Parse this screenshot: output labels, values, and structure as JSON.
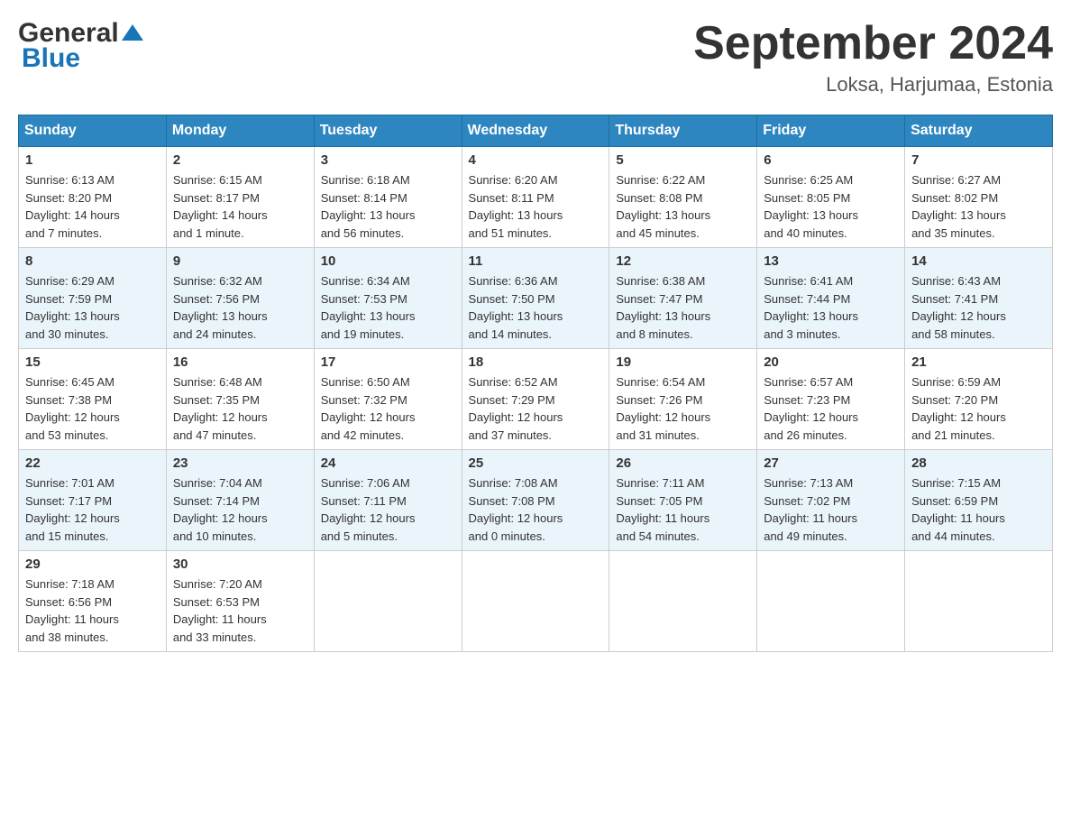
{
  "header": {
    "logo_general": "General",
    "logo_blue": "Blue",
    "title": "September 2024",
    "subtitle": "Loksa, Harjumaa, Estonia"
  },
  "weekdays": [
    "Sunday",
    "Monday",
    "Tuesday",
    "Wednesday",
    "Thursday",
    "Friday",
    "Saturday"
  ],
  "weeks": [
    [
      {
        "day": "1",
        "sunrise": "6:13 AM",
        "sunset": "8:20 PM",
        "daylight": "14 hours and 7 minutes."
      },
      {
        "day": "2",
        "sunrise": "6:15 AM",
        "sunset": "8:17 PM",
        "daylight": "14 hours and 1 minute."
      },
      {
        "day": "3",
        "sunrise": "6:18 AM",
        "sunset": "8:14 PM",
        "daylight": "13 hours and 56 minutes."
      },
      {
        "day": "4",
        "sunrise": "6:20 AM",
        "sunset": "8:11 PM",
        "daylight": "13 hours and 51 minutes."
      },
      {
        "day": "5",
        "sunrise": "6:22 AM",
        "sunset": "8:08 PM",
        "daylight": "13 hours and 45 minutes."
      },
      {
        "day": "6",
        "sunrise": "6:25 AM",
        "sunset": "8:05 PM",
        "daylight": "13 hours and 40 minutes."
      },
      {
        "day": "7",
        "sunrise": "6:27 AM",
        "sunset": "8:02 PM",
        "daylight": "13 hours and 35 minutes."
      }
    ],
    [
      {
        "day": "8",
        "sunrise": "6:29 AM",
        "sunset": "7:59 PM",
        "daylight": "13 hours and 30 minutes."
      },
      {
        "day": "9",
        "sunrise": "6:32 AM",
        "sunset": "7:56 PM",
        "daylight": "13 hours and 24 minutes."
      },
      {
        "day": "10",
        "sunrise": "6:34 AM",
        "sunset": "7:53 PM",
        "daylight": "13 hours and 19 minutes."
      },
      {
        "day": "11",
        "sunrise": "6:36 AM",
        "sunset": "7:50 PM",
        "daylight": "13 hours and 14 minutes."
      },
      {
        "day": "12",
        "sunrise": "6:38 AM",
        "sunset": "7:47 PM",
        "daylight": "13 hours and 8 minutes."
      },
      {
        "day": "13",
        "sunrise": "6:41 AM",
        "sunset": "7:44 PM",
        "daylight": "13 hours and 3 minutes."
      },
      {
        "day": "14",
        "sunrise": "6:43 AM",
        "sunset": "7:41 PM",
        "daylight": "12 hours and 58 minutes."
      }
    ],
    [
      {
        "day": "15",
        "sunrise": "6:45 AM",
        "sunset": "7:38 PM",
        "daylight": "12 hours and 53 minutes."
      },
      {
        "day": "16",
        "sunrise": "6:48 AM",
        "sunset": "7:35 PM",
        "daylight": "12 hours and 47 minutes."
      },
      {
        "day": "17",
        "sunrise": "6:50 AM",
        "sunset": "7:32 PM",
        "daylight": "12 hours and 42 minutes."
      },
      {
        "day": "18",
        "sunrise": "6:52 AM",
        "sunset": "7:29 PM",
        "daylight": "12 hours and 37 minutes."
      },
      {
        "day": "19",
        "sunrise": "6:54 AM",
        "sunset": "7:26 PM",
        "daylight": "12 hours and 31 minutes."
      },
      {
        "day": "20",
        "sunrise": "6:57 AM",
        "sunset": "7:23 PM",
        "daylight": "12 hours and 26 minutes."
      },
      {
        "day": "21",
        "sunrise": "6:59 AM",
        "sunset": "7:20 PM",
        "daylight": "12 hours and 21 minutes."
      }
    ],
    [
      {
        "day": "22",
        "sunrise": "7:01 AM",
        "sunset": "7:17 PM",
        "daylight": "12 hours and 15 minutes."
      },
      {
        "day": "23",
        "sunrise": "7:04 AM",
        "sunset": "7:14 PM",
        "daylight": "12 hours and 10 minutes."
      },
      {
        "day": "24",
        "sunrise": "7:06 AM",
        "sunset": "7:11 PM",
        "daylight": "12 hours and 5 minutes."
      },
      {
        "day": "25",
        "sunrise": "7:08 AM",
        "sunset": "7:08 PM",
        "daylight": "12 hours and 0 minutes."
      },
      {
        "day": "26",
        "sunrise": "7:11 AM",
        "sunset": "7:05 PM",
        "daylight": "11 hours and 54 minutes."
      },
      {
        "day": "27",
        "sunrise": "7:13 AM",
        "sunset": "7:02 PM",
        "daylight": "11 hours and 49 minutes."
      },
      {
        "day": "28",
        "sunrise": "7:15 AM",
        "sunset": "6:59 PM",
        "daylight": "11 hours and 44 minutes."
      }
    ],
    [
      {
        "day": "29",
        "sunrise": "7:18 AM",
        "sunset": "6:56 PM",
        "daylight": "11 hours and 38 minutes."
      },
      {
        "day": "30",
        "sunrise": "7:20 AM",
        "sunset": "6:53 PM",
        "daylight": "11 hours and 33 minutes."
      },
      null,
      null,
      null,
      null,
      null
    ]
  ]
}
